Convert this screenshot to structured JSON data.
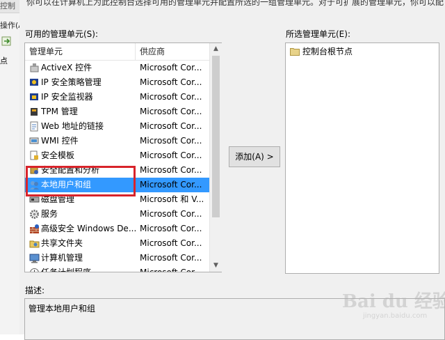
{
  "background_window": {
    "title": "控制",
    "menu_item": "操作(A)",
    "node_label": "点"
  },
  "dialog": {
    "intro_text": "你可以在计算机上为此控制台选择可用的管理单元并配置所选的一组管理单元。对于可扩展的管理单元，你可以配置",
    "available_label": "可用的管理单元(S):",
    "selected_label": "所选管理单元(E):",
    "columns": {
      "name": "管理单元",
      "vendor": "供应商"
    },
    "snapins": [
      {
        "name": "ActiveX 控件",
        "vendor": "Microsoft Cor...",
        "icon": "activex-icon"
      },
      {
        "name": "IP 安全策略管理",
        "vendor": "Microsoft Cor...",
        "icon": "ip-security-policy-icon"
      },
      {
        "name": "IP 安全监视器",
        "vendor": "Microsoft Cor...",
        "icon": "ip-security-monitor-icon"
      },
      {
        "name": "TPM 管理",
        "vendor": "Microsoft Cor...",
        "icon": "tpm-icon"
      },
      {
        "name": "Web 地址的链接",
        "vendor": "Microsoft Cor...",
        "icon": "web-link-icon"
      },
      {
        "name": "WMI 控件",
        "vendor": "Microsoft Cor...",
        "icon": "wmi-icon"
      },
      {
        "name": "安全模板",
        "vendor": "Microsoft Cor...",
        "icon": "security-template-icon"
      },
      {
        "name": "安全配置和分析",
        "vendor": "Microsoft Cor...",
        "icon": "security-config-icon"
      },
      {
        "name": "本地用户和组",
        "vendor": "Microsoft Cor...",
        "icon": "local-users-icon",
        "selected": true
      },
      {
        "name": "磁盘管理",
        "vendor": "Microsoft 和 V...",
        "icon": "disk-management-icon"
      },
      {
        "name": "服务",
        "vendor": "Microsoft Cor...",
        "icon": "services-gear-icon"
      },
      {
        "name": "高级安全 Windows De...",
        "vendor": "Microsoft Cor...",
        "icon": "firewall-icon"
      },
      {
        "name": "共享文件夹",
        "vendor": "Microsoft Cor...",
        "icon": "shared-folder-icon"
      },
      {
        "name": "计算机管理",
        "vendor": "Microsoft Cor...",
        "icon": "computer-management-icon"
      },
      {
        "name": "任务计划程序",
        "vendor": "Microsoft Cor...",
        "icon": "task-scheduler-icon"
      }
    ],
    "add_button": "添加(A) >",
    "selected_items": [
      {
        "name": "控制台根节点",
        "icon": "folder-icon"
      }
    ],
    "description_label": "描述:",
    "description_text": "管理本地用户和组"
  },
  "colors": {
    "selection": "#3399ff",
    "highlight_box": "#d8232a",
    "dialog_bg": "#f0f0f0"
  },
  "watermark": {
    "brand": "Bai du 经验",
    "url": "jingyan.baidu.com"
  }
}
